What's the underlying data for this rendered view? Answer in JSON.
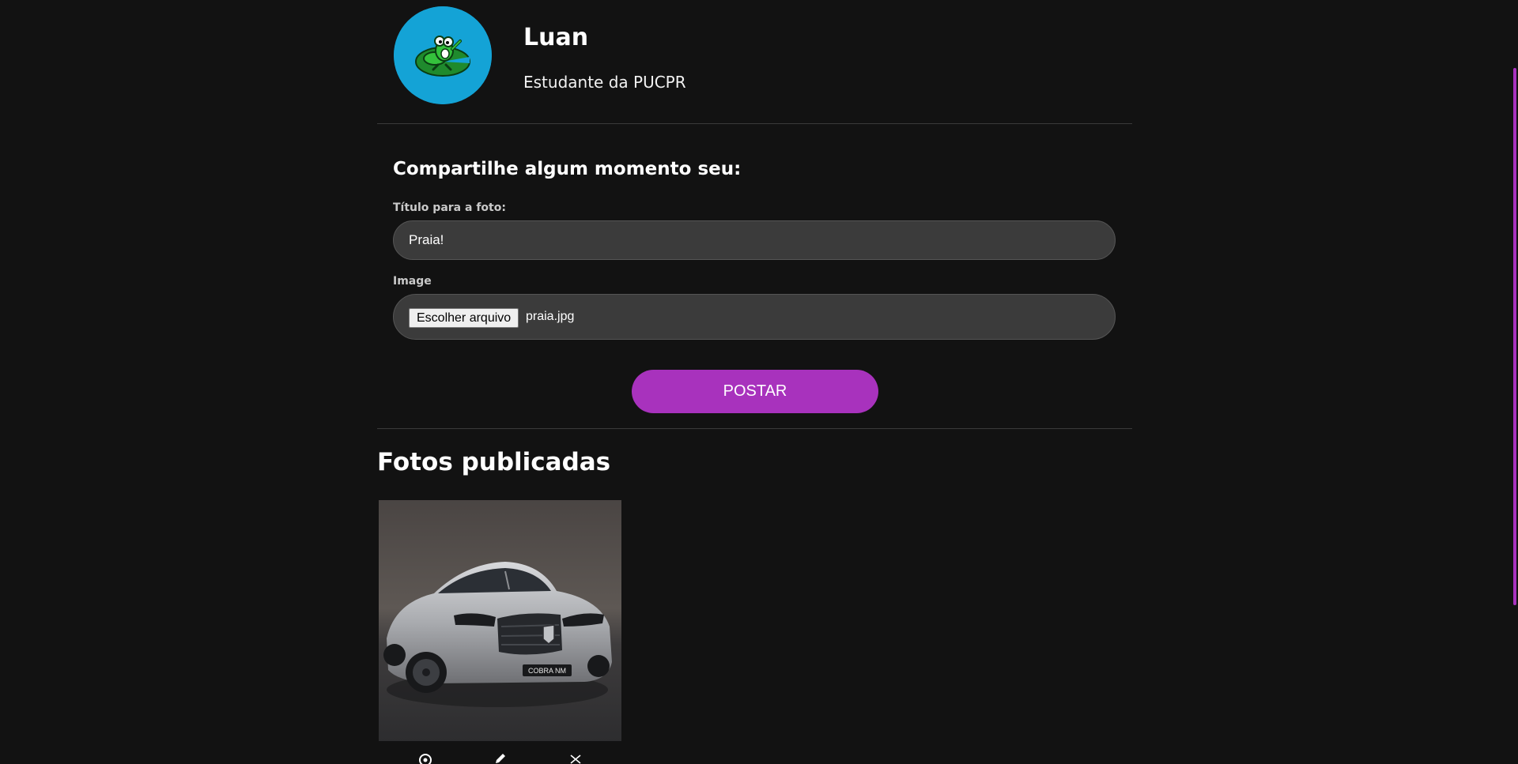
{
  "profile": {
    "name": "Luan",
    "bio": "Estudante da PUCPR",
    "avatar_icon": "frog-on-lily-pad-icon"
  },
  "upload_form": {
    "heading": "Compartilhe algum momento seu:",
    "title_label": "Título para a foto:",
    "title_value": "Praia!",
    "image_label": "Image",
    "file_button_label": "Escolher arquivo",
    "file_name": "praia.jpg",
    "submit_label": "POSTAR"
  },
  "gallery": {
    "heading": "Fotos publicadas",
    "photos": [
      {
        "plate_text": "COBRA NM",
        "actions": [
          "view-icon",
          "edit-icon",
          "delete-icon"
        ]
      }
    ]
  },
  "colors": {
    "background": "#121212",
    "accent": "#a832bd",
    "input_background": "#3b3b3b",
    "avatar_background": "#14a3d6"
  }
}
